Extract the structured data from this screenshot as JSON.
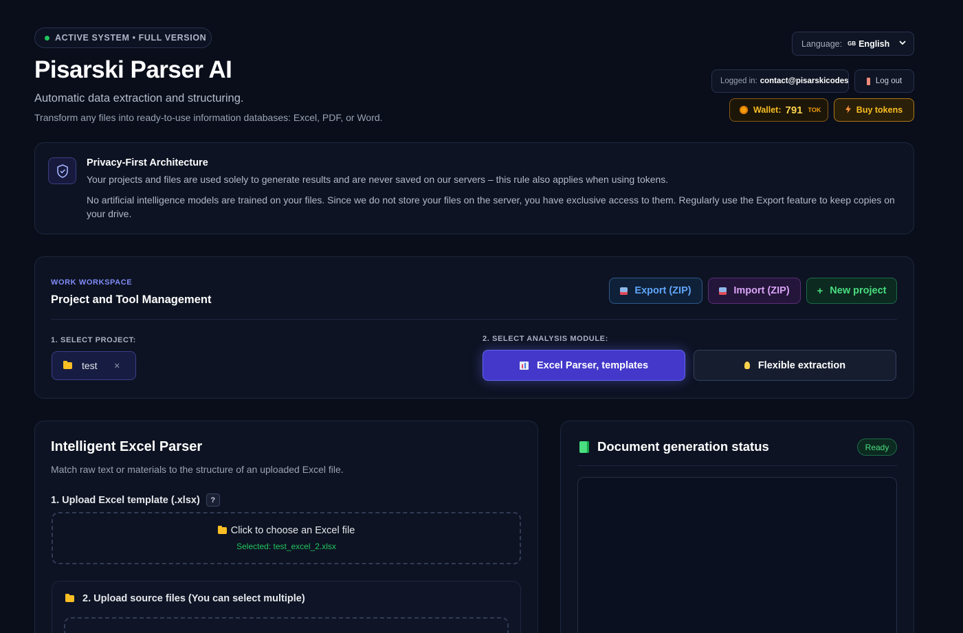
{
  "header": {
    "status_pill": "ACTIVE SYSTEM • FULL VERSION",
    "title": "Pisarski Parser AI",
    "subtitle": "Automatic data extraction and structuring.",
    "description": "Transform any files into ready-to-use information databases: Excel, PDF, or Word."
  },
  "account": {
    "language_label": "Language:",
    "language_flag": "GB",
    "language_value": "English",
    "logged_in_label": "Logged in:",
    "email": "contact@pisarskicodest",
    "logout_label": "Log out",
    "wallet_label": "Wallet:",
    "wallet_amount": "791",
    "wallet_unit": "TOK",
    "buy_label": "Buy tokens"
  },
  "privacy": {
    "title": "Privacy-First Architecture",
    "p1": "Your projects and files are used solely to generate results and are never saved on our servers – this rule also applies when using tokens.",
    "p2": "No artificial intelligence models are trained on your files. Since we do not store your files on the server, you have exclusive access to them. Regularly use the Export feature to keep copies on your drive."
  },
  "workspace": {
    "kicker": "WORK WORKSPACE",
    "title": "Project and Tool Management",
    "export_label": "Export (ZIP)",
    "import_label": "Import (ZIP)",
    "new_project_label": "New project",
    "select_project_label": "1. SELECT PROJECT:",
    "project_name": "test",
    "select_module_label": "2. SELECT ANALYSIS MODULE:",
    "modules": [
      {
        "label": "Excel Parser, templates",
        "active": true
      },
      {
        "label": "Flexible extraction",
        "active": false
      }
    ]
  },
  "parser": {
    "title": "Intelligent Excel Parser",
    "subtitle": "Match raw text or materials to the structure of an uploaded Excel file.",
    "upload_template_label": "1. Upload Excel template (.xlsx)",
    "help": "?",
    "drop_main": "Click to choose an Excel file",
    "selected_file": "Selected: test_excel_2.xlsx",
    "sources_label": "2. Upload source files (You can select multiple)"
  },
  "status": {
    "title": "Document generation status",
    "badge": "Ready"
  },
  "colors": {
    "background": "#090e1a",
    "accent": "#4338ca",
    "success": "#22c55e",
    "warning": "#fbbf24"
  }
}
